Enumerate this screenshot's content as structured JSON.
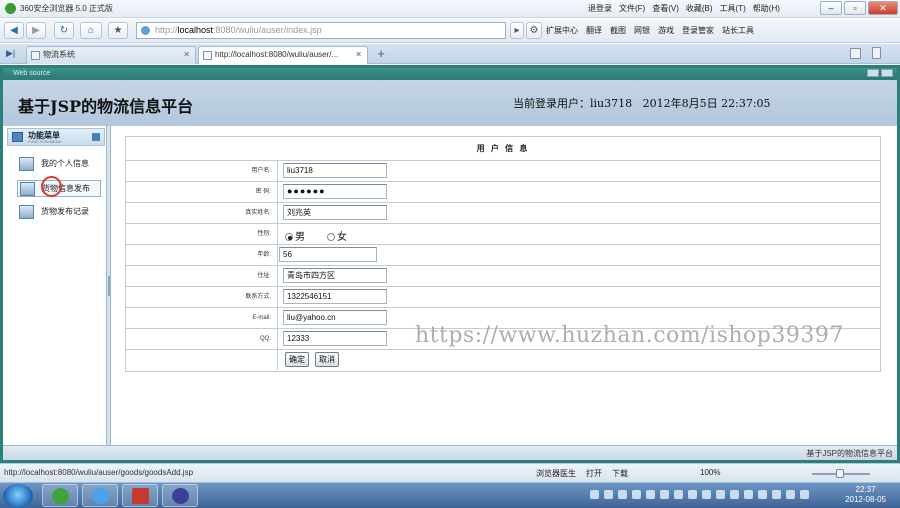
{
  "browser": {
    "title": "360安全浏览器 5.0 正式版",
    "menu": [
      "退登录",
      "文件(F)",
      "查看(V)",
      "收藏(B)",
      "工具(T)",
      "帮助(H)"
    ],
    "address": {
      "prefix": "http://",
      "host": "localhost",
      "rest": ":8080/wuliu/auser/index.jsp"
    },
    "tools": [
      "扩展中心",
      "翻译",
      "截图",
      "网银",
      "游戏",
      "登录管家",
      "站长工具"
    ],
    "tabs": [
      {
        "label": "物流系统"
      },
      {
        "label": "http://localhost:8080/wuliu/auser/..."
      }
    ],
    "status_url": "http://localhost:8080/wuliu/auser/goods/goodsAdd.jsp",
    "status_items": [
      "浏览器医生",
      "打开",
      "下载"
    ],
    "zoom": "100%"
  },
  "app": {
    "frame_title": "Web source",
    "site_title": "基于JSP的物流信息平台",
    "login_label": "当前登录用户：",
    "login_user": "liu3718",
    "login_datetime": "2012年8月5日  22:37:05",
    "sidebar": {
      "title": "功能菜单",
      "subtitle": "FUNCTION MENU",
      "items": [
        {
          "label": "我的个人信息"
        },
        {
          "label": "货物信息发布"
        },
        {
          "label": "货物发布记录"
        }
      ]
    },
    "form": {
      "title": "用 户 信 息",
      "fields": {
        "username_label": "用户名:",
        "username_value": "liu3718",
        "password_label": "密  码:",
        "password_value": "●●●●●●",
        "realname_label": "真实姓名:",
        "realname_value": "刘兆英",
        "gender_label": "性别:",
        "gender_male": "男",
        "gender_female": "女",
        "gender_selected": "男",
        "age_label": "年龄:",
        "age_value": "56",
        "address_label": "住址:",
        "address_value": "青岛市四方区",
        "phone_label": "联系方式:",
        "phone_value": "1322546151",
        "email_label": "E-mail:",
        "email_value": "liu@yahoo.cn",
        "qq_label": "QQ:",
        "qq_value": "12333"
      },
      "submit_label": "确定",
      "cancel_label": "取消"
    },
    "footer_text": "基于JSP的物流信息平台"
  },
  "watermark": "https://www.huzhan.com/ishop39397",
  "taskbar": {
    "time": "22:37",
    "date": "2012-08-05"
  }
}
